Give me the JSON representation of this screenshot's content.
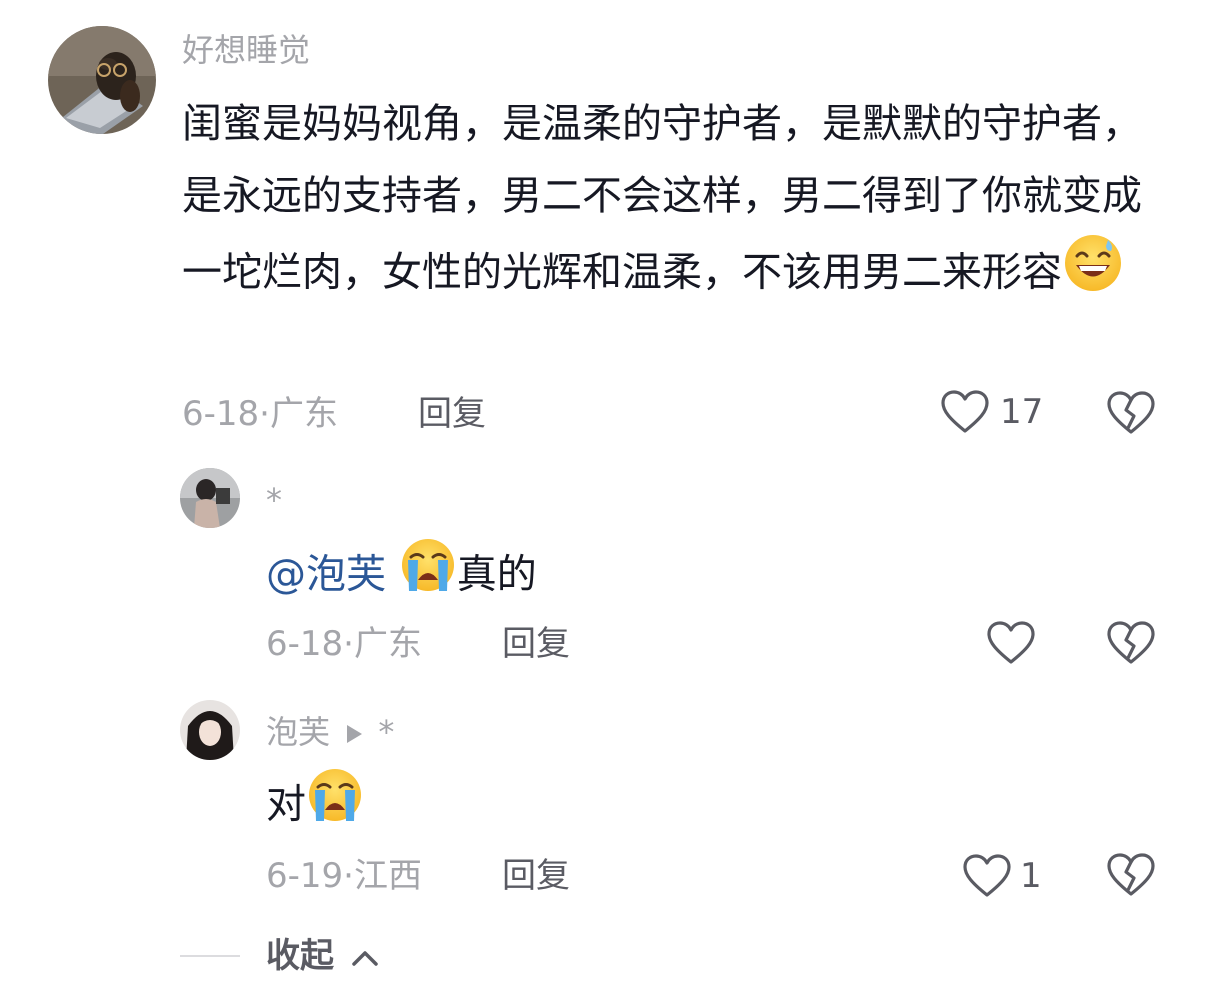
{
  "comments": [
    {
      "username": "好想睡觉",
      "text": "闺蜜是妈妈视角，是温柔的守护者，是默默的守护者，是永远的支持者，男二不会这样，男二得到了你就变成一坨烂肉，女性的光辉和温柔，不该用男二来形容",
      "emoji": "grinning-sweat-emoji",
      "date": "6-18",
      "location": "广东",
      "reply_label": "回复",
      "like_count": "17",
      "like_icon": "heart-outline-icon",
      "dislike_icon": "broken-heart-icon"
    }
  ],
  "replies": [
    {
      "username": "*",
      "mention": "@泡芙",
      "emoji": "loudly-crying-emoji",
      "text": "真的",
      "date": "6-18",
      "location": "广东",
      "reply_label": "回复",
      "like_count": ""
    },
    {
      "username": "泡芙",
      "reply_to_icon": "play-arrow-icon",
      "reply_to_name": "*",
      "text": "对",
      "emoji": "loudly-crying-emoji",
      "date": "6-19",
      "location": "江西",
      "reply_label": "回复",
      "like_count": "1"
    }
  ],
  "collapse_label": "收起",
  "colors": {
    "text": "#161823",
    "meta": "#a4a5aa",
    "secondary": "#5a5b63",
    "mention": "#2b5797"
  }
}
